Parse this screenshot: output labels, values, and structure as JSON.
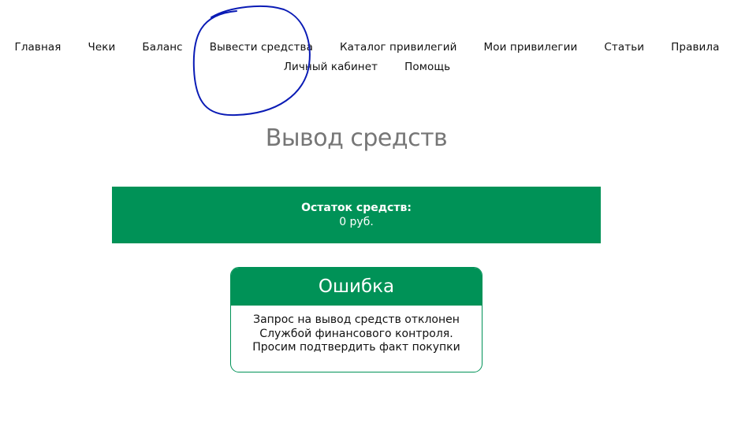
{
  "nav": {
    "row1": [
      "Главная",
      "Чеки",
      "Баланс",
      "Вывести средства",
      "Каталог привилегий",
      "Мои привилегии",
      "Статьи",
      "Правила"
    ],
    "row2": [
      "Личный кабинет",
      "Помощь"
    ],
    "highlighted_item": "Вывести средства"
  },
  "page": {
    "title": "Вывод средств"
  },
  "balance": {
    "label": "Остаток средств:",
    "value": "0 руб."
  },
  "error": {
    "title": "Ошибка",
    "lines": [
      "Запрос на вывод средств отклонен",
      "Службой финансового контроля.",
      "Просим подтвердить факт покупки"
    ]
  },
  "colors": {
    "accent": "#009257",
    "title_gray": "#767676",
    "annotation": "#0a1bb5",
    "text": "#111111"
  }
}
